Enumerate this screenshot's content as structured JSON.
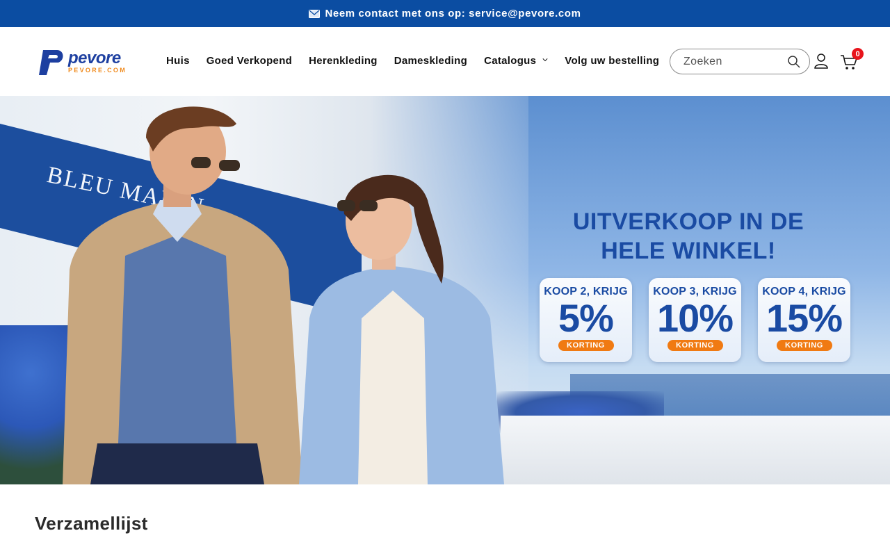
{
  "announcement": {
    "text": "Neem contact met ons op: service@pevore.com",
    "icon": "envelope-icon"
  },
  "logo": {
    "name": "pevore",
    "sub": "PEVORE.COM",
    "mark": "P"
  },
  "nav": {
    "items": [
      {
        "label": "Huis"
      },
      {
        "label": "Goed Verkopend"
      },
      {
        "label": "Herenkleding"
      },
      {
        "label": "Dameskleding"
      },
      {
        "label": "Catalogus",
        "has_dropdown": true
      },
      {
        "label": "Volg uw bestelling"
      }
    ]
  },
  "search": {
    "placeholder": "Zoeken",
    "value": ""
  },
  "cart": {
    "count": "0"
  },
  "hero": {
    "storefront_sign": "BLEU MARIN",
    "headline_line1": "UITVERKOOP IN DE",
    "headline_line2": "HELE WINKEL!",
    "offers": [
      {
        "title": "KOOP 2, KRIJG",
        "percent": "5%",
        "badge": "KORTING"
      },
      {
        "title": "KOOP 3, KRIJG",
        "percent": "10%",
        "badge": "KORTING"
      },
      {
        "title": "KOOP 4, KRIJG",
        "percent": "15%",
        "badge": "KORTING"
      }
    ]
  },
  "section": {
    "title": "Verzamellijst"
  },
  "colors": {
    "brand_blue": "#0b4da2",
    "accent_orange": "#f07a12",
    "badge_red": "#e8141c"
  }
}
